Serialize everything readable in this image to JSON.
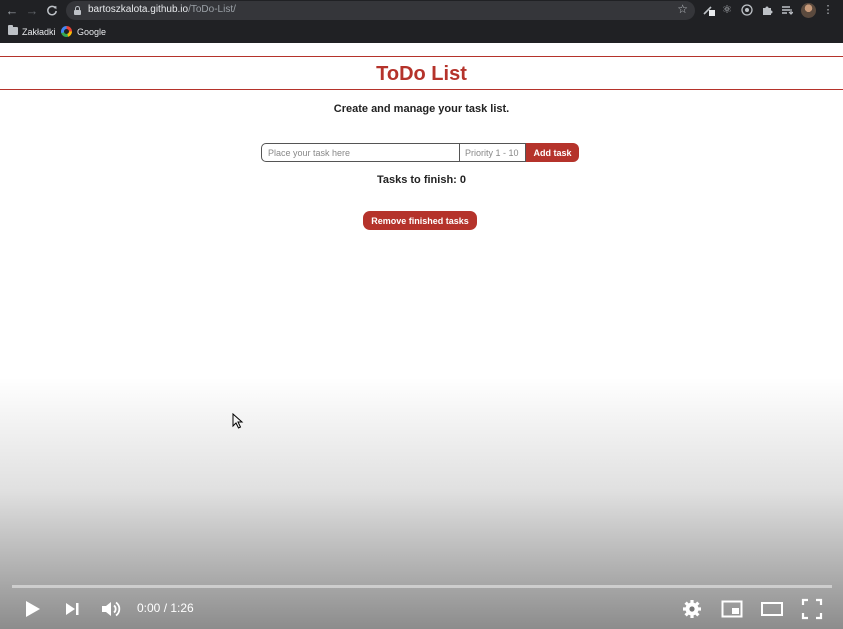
{
  "browser": {
    "url_host": "bartoszkalota.github.io",
    "url_path": "/ToDo-List/",
    "icons": [
      "back-icon",
      "forward-icon",
      "reload-icon",
      "lock-icon",
      "star-icon",
      "extension-icons",
      "puzzle-icon",
      "reading-list-icon",
      "avatar",
      "menu-icon"
    ],
    "bookmarks": [
      {
        "label": "Zakładki",
        "icon": "folder-icon"
      },
      {
        "label": "Google",
        "icon": "google-icon"
      }
    ]
  },
  "app": {
    "title": "ToDo List",
    "subtitle": "Create and manage your task list.",
    "task_placeholder": "Place your task here",
    "priority_placeholder": "Priority 1 - 10",
    "add_button": "Add task",
    "counter_label": "Tasks to finish:",
    "counter_value": "0",
    "remove_button": "Remove finished tasks",
    "accent_color": "#b5332b"
  },
  "player": {
    "time_current": "0:00",
    "time_separator": " / ",
    "time_total": "1:26",
    "progress": 0,
    "icons": [
      "play-icon",
      "next-icon",
      "volume-icon",
      "settings-icon",
      "miniplayer-icon",
      "theater-icon",
      "fullscreen-icon"
    ]
  }
}
